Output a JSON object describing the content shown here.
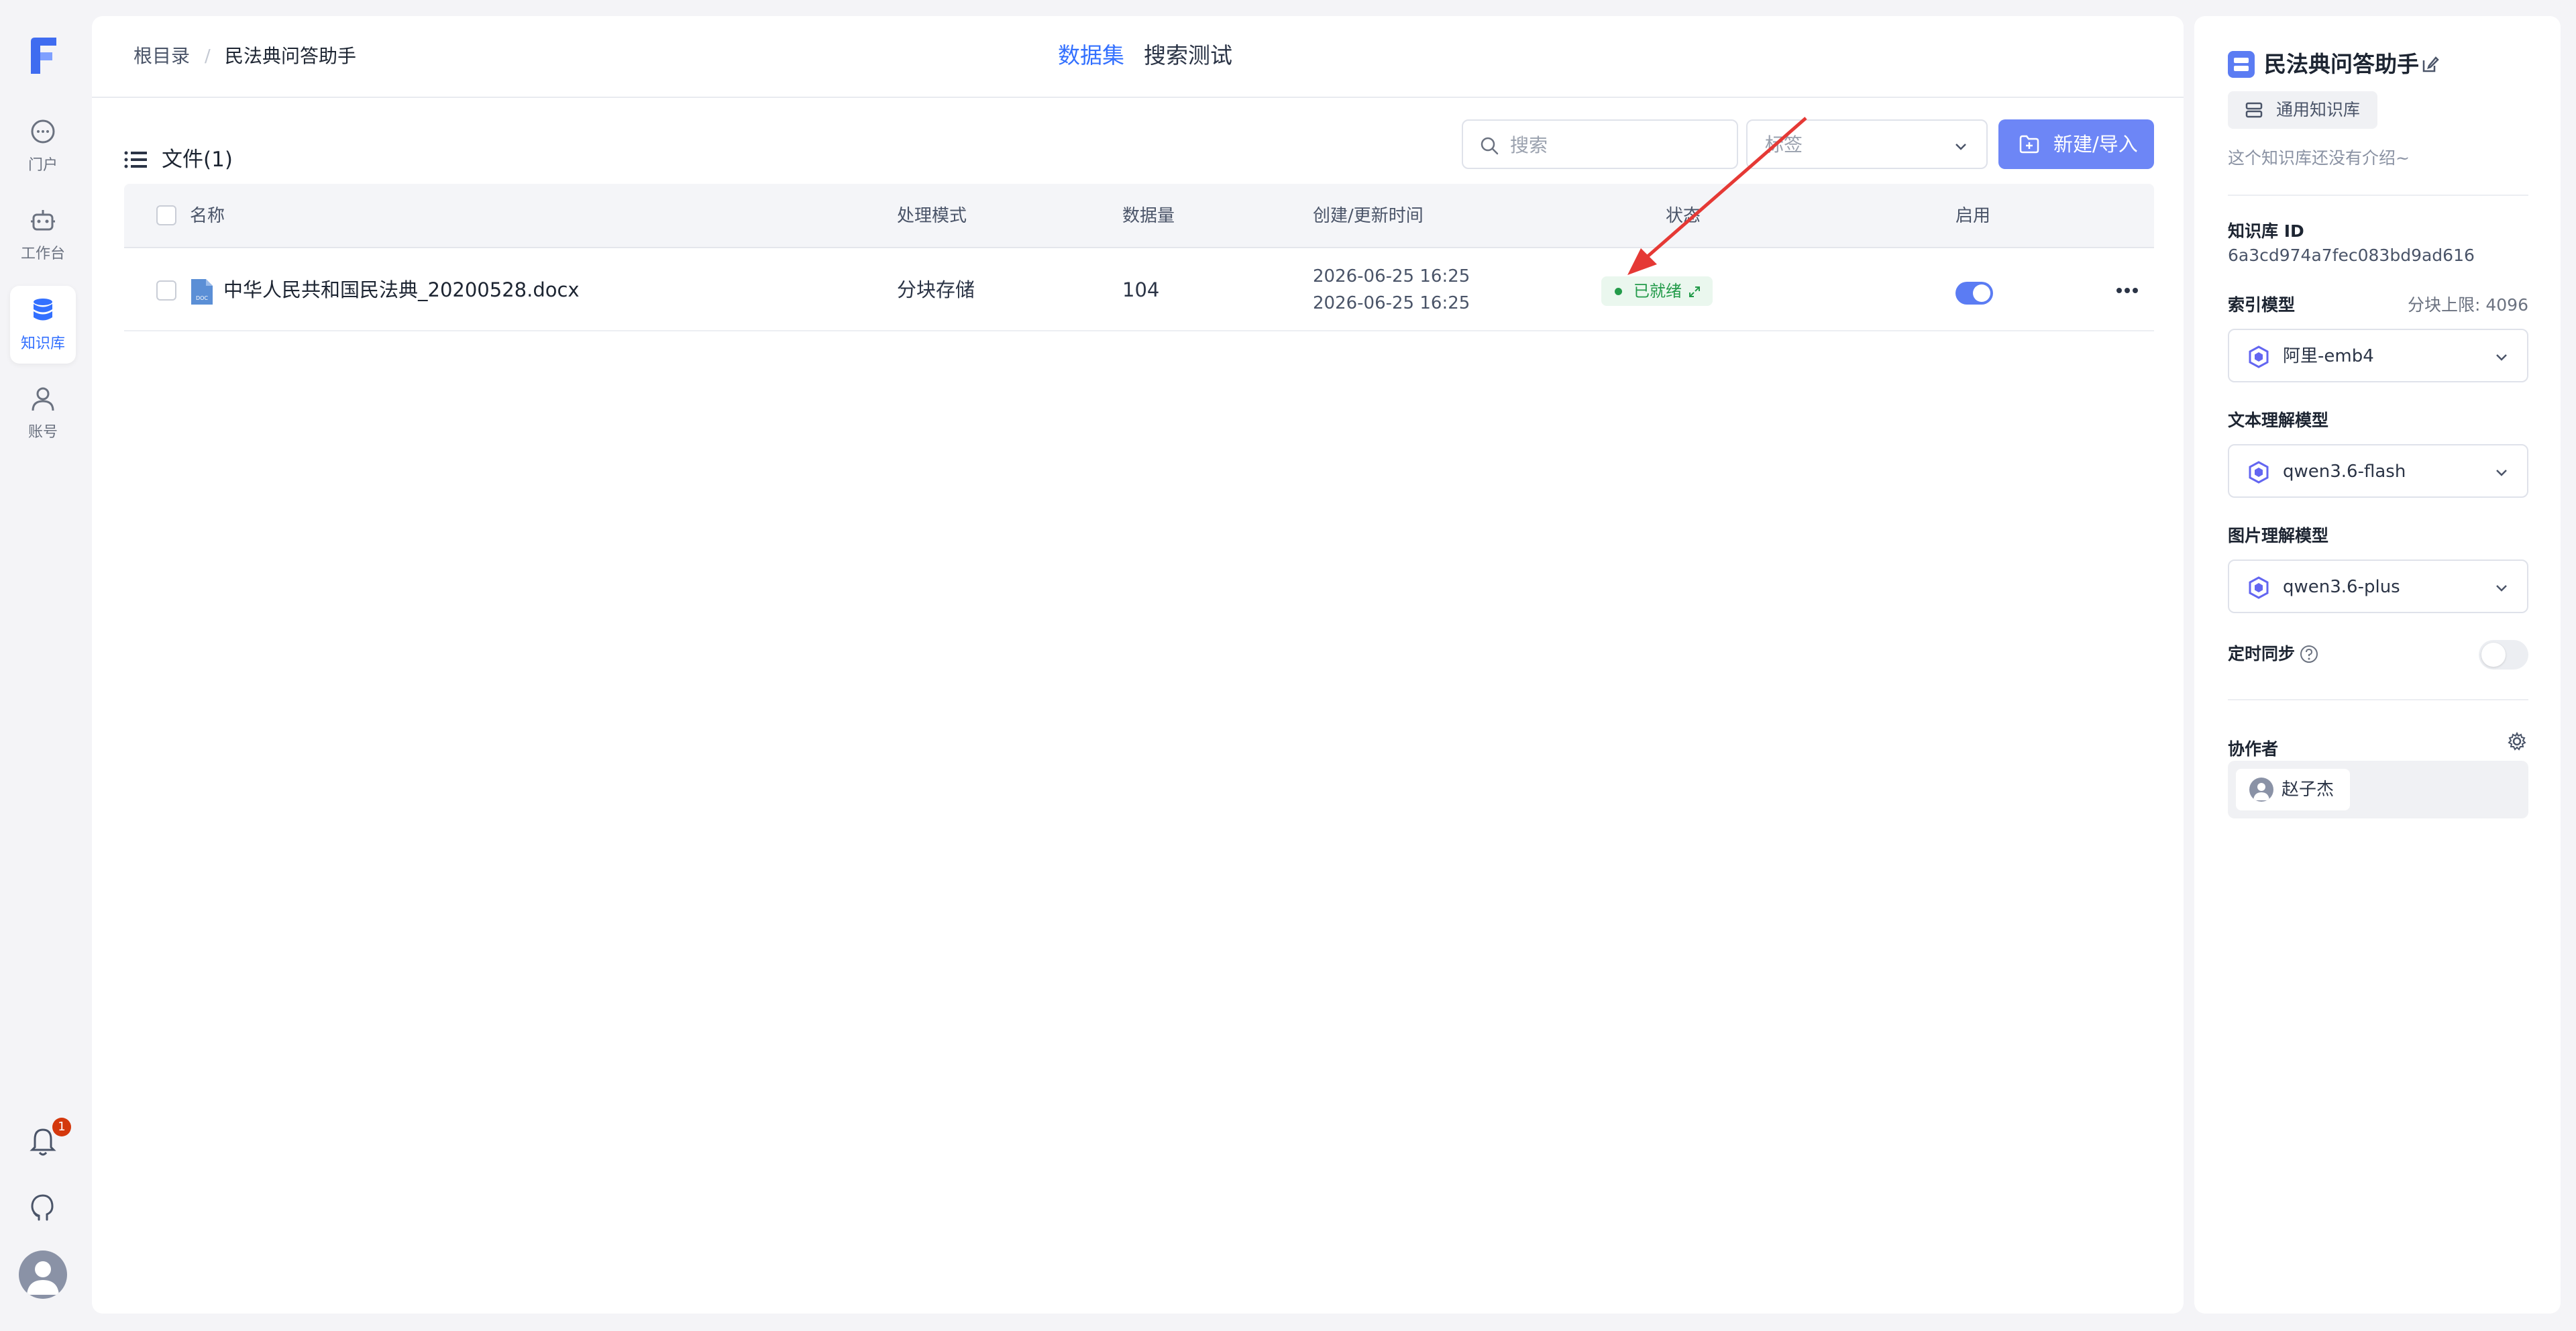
{
  "nav": {
    "items": [
      {
        "label": "门户",
        "icon": "chat-icon"
      },
      {
        "label": "工作台",
        "icon": "robot-icon"
      },
      {
        "label": "知识库",
        "icon": "database-icon",
        "active": true
      },
      {
        "label": "账号",
        "icon": "user-icon"
      }
    ],
    "notification_count": "1"
  },
  "breadcrumb": {
    "root": "根目录",
    "separator": "/",
    "current": "民法典问答助手"
  },
  "tabs": {
    "dataset": "数据集",
    "search_test": "搜索测试"
  },
  "files": {
    "title": "文件(1)",
    "search_placeholder": "搜索",
    "tag_placeholder": "标签",
    "new_button": "新建/导入",
    "columns": {
      "name": "名称",
      "mode": "处理模式",
      "count": "数据量",
      "time": "创建/更新时间",
      "status": "状态",
      "enabled": "启用"
    },
    "rows": [
      {
        "name": "中华人民共和国民法典_20200528.docx",
        "mode": "分块存储",
        "count": "104",
        "created": "2026-06-25 16:25",
        "updated": "2026-06-25 16:25",
        "status": "已就绪",
        "enabled": true,
        "file_icon": "DOC"
      }
    ]
  },
  "side": {
    "title": "民法典问答助手",
    "type": "通用知识库",
    "intro": "这个知识库还没有介绍~",
    "id_label": "知识库 ID",
    "id_value": "6a3cd974a7fec083bd9ad616",
    "index_model_label": "索引模型",
    "chunk_limit": "分块上限: 4096",
    "index_model": "阿里-emb4",
    "text_model_label": "文本理解模型",
    "text_model": "qwen3.6-flash",
    "image_model_label": "图片理解模型",
    "image_model": "qwen3.6-plus",
    "sync_label": "定时同步",
    "sync_enabled": false,
    "collab_label": "协作者",
    "collaborator": "赵子杰"
  },
  "colors": {
    "accent": "#3370ff",
    "button": "#6d86f6",
    "status_ok": "#239b4a",
    "annotation_arrow": "#e53935"
  }
}
